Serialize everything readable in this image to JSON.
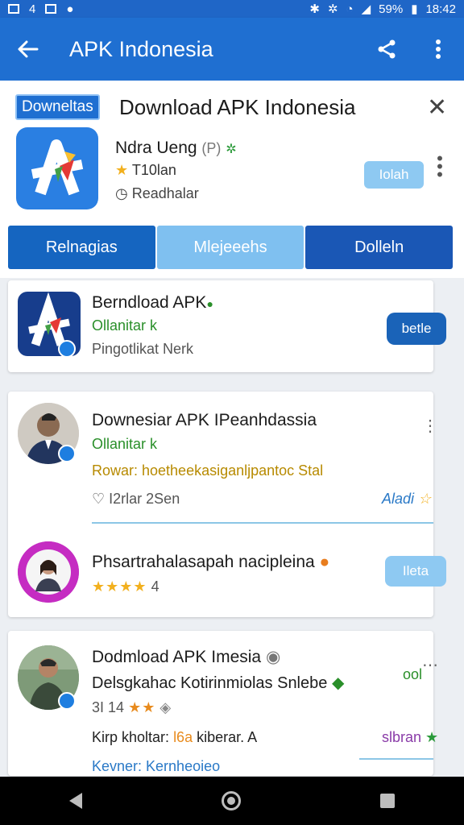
{
  "status_bar": {
    "left_glyphs": [
      "4"
    ],
    "battery": "59%",
    "time": "18:42"
  },
  "app_bar": {
    "title": "APK Indonesia"
  },
  "header": {
    "badge": "Downeltas",
    "title": "Download APK Indonesia",
    "app_name": "Ndra Ueng",
    "app_tag": "(P)",
    "rating_text": "T10lan",
    "status_text": "Readhalar",
    "install_label": "Iolah",
    "tabs": [
      "Relnagias",
      "Mlejeeehs",
      "Dolleln"
    ]
  },
  "cards": [
    {
      "title": "Berndload APK",
      "subtitle": "Ollanitar k",
      "meta": "Pingotlikat Nerk",
      "button": "betle"
    },
    {
      "title": "Downesiar APK IPeanhdassia",
      "subtitle": "Ollanitar k",
      "line3": "Rowar: hoetheekasiganljpantoc Stal",
      "meta": "I2rlar 2Sen",
      "right_label": "Aladi",
      "second_title": "Phsartrahalasapah nacipleina",
      "rating_stars": "★★★★",
      "rating_suffix": "4",
      "second_button": "Ileta"
    },
    {
      "title": "Dodmload APK Imesia",
      "subtitle": "Delsgkahac Kotirinmiolas Snlebe",
      "rating_num": "3I 14",
      "rating_stars": "★★",
      "right_small": "ool",
      "meta": "Kirp kholtar:",
      "meta_orange": "l6a",
      "meta_rest": "kiberar.",
      "meta_suffix": "A",
      "right_label": "slbran",
      "bottom_line": "Kevner: Kernheoieo"
    }
  ],
  "colors": {
    "primary": "#1f6fd1",
    "light_button": "#8ec9f2",
    "green_text": "#2a8f2a",
    "star": "#f2b01e"
  },
  "icons": [
    "back-arrow-icon",
    "share-icon",
    "more-vertical-icon",
    "close-icon",
    "star-icon",
    "clock-icon",
    "heart-icon"
  ]
}
